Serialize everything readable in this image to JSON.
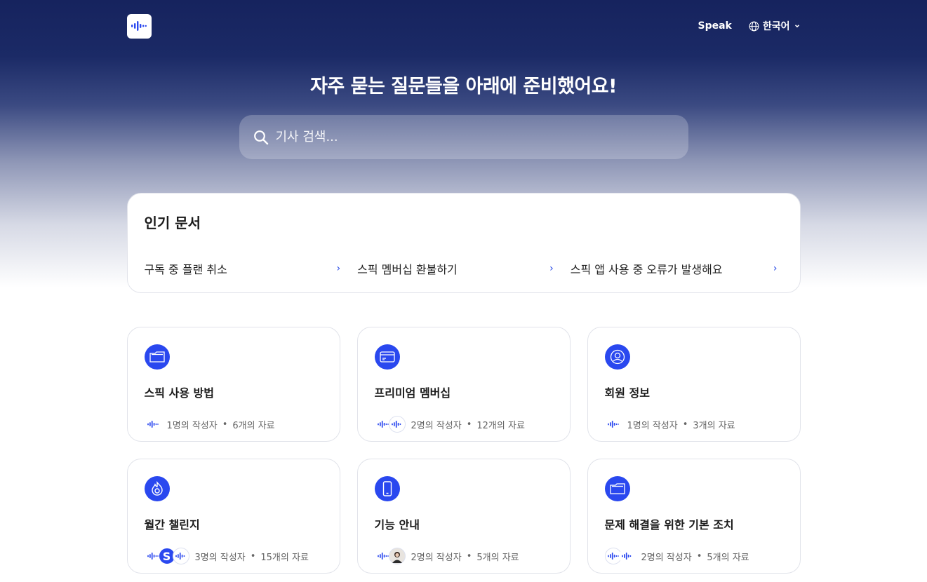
{
  "header": {
    "logo_icon": "speak-waveform-icon",
    "nav_link": "Speak",
    "language": "한국어"
  },
  "hero": {
    "title": "자주 묻는 질문들을 아래에 준비했어요!",
    "search_placeholder": "기사 검색..."
  },
  "popular": {
    "title": "인기 문서",
    "items": [
      {
        "label": "구독 중 플랜 취소"
      },
      {
        "label": "스픽 멤버십 환불하기"
      },
      {
        "label": "스픽 앱 사용 중 오류가 발생해요"
      }
    ]
  },
  "collections": [
    {
      "icon": "folder-icon",
      "title": "스픽 사용 방법",
      "authors": "1명의 작성자",
      "articles": "6개의 자료"
    },
    {
      "icon": "credit-card-icon",
      "title": "프리미엄 멤버십",
      "authors": "2명의 작성자",
      "articles": "12개의 자료"
    },
    {
      "icon": "user-circle-icon",
      "title": "회원 정보",
      "authors": "1명의 작성자",
      "articles": "3개의 자료"
    },
    {
      "icon": "flame-icon",
      "title": "월간 챌린지",
      "authors": "3명의 작성자",
      "articles": "15개의 자료"
    },
    {
      "icon": "smartphone-icon",
      "title": "기능 안내",
      "authors": "2명의 작성자",
      "articles": "5개의 자료"
    },
    {
      "icon": "folder-icon",
      "title": "문제 해결을 위한 기본 조치",
      "authors": "2명의 작성자",
      "articles": "5개의 자료"
    }
  ],
  "colors": {
    "accent": "#2a48ef",
    "header_bg": "#16235e"
  }
}
